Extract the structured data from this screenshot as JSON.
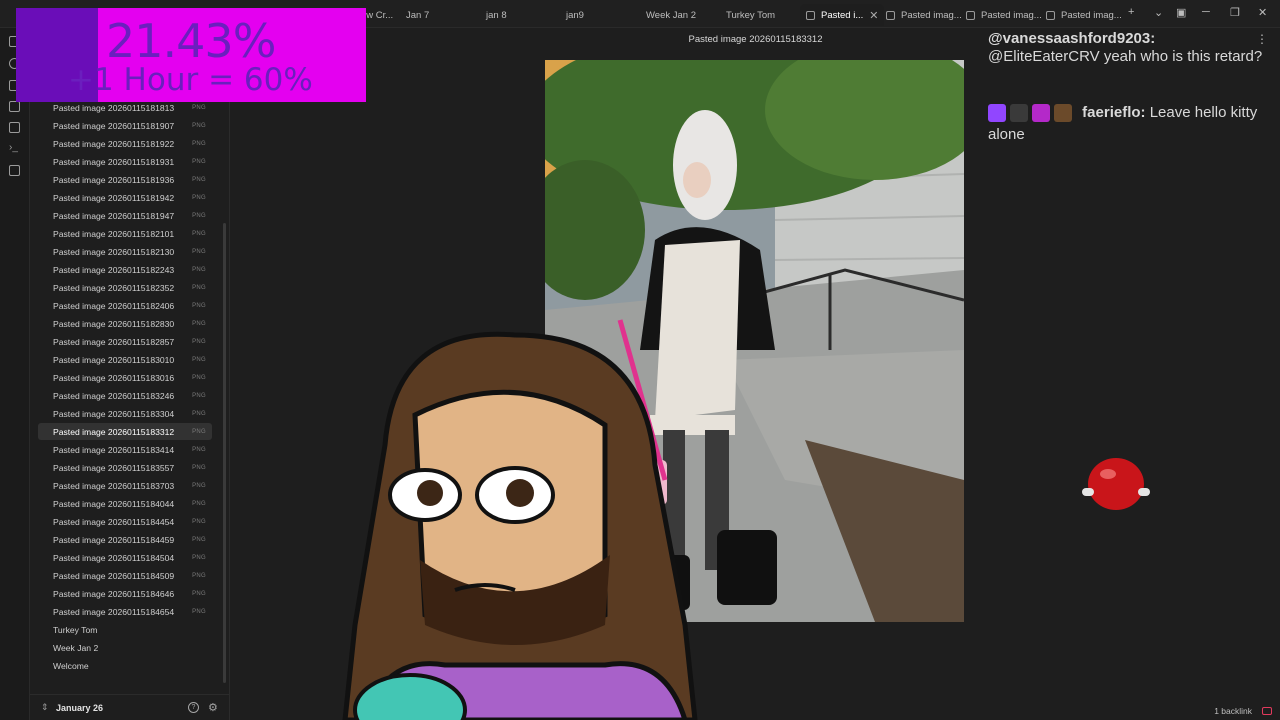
{
  "tabs": [
    {
      "label": "ew Cr..."
    },
    {
      "label": "Jan 7"
    },
    {
      "label": "jan 8"
    },
    {
      "label": "jan9"
    },
    {
      "label": "Week Jan 2"
    },
    {
      "label": "Turkey Tom"
    },
    {
      "label": "Pasted i..."
    },
    {
      "label": "Pasted imag..."
    },
    {
      "label": "Pasted imag..."
    },
    {
      "label": "Pasted imag..."
    }
  ],
  "overlay": {
    "percent": "21.43%",
    "bonus": "+1 Hour = 60%"
  },
  "sidebar": {
    "files": [
      {
        "name": "Pasted image 20260115181813",
        "ext": "PNG"
      },
      {
        "name": "Pasted image 20260115181907",
        "ext": "PNG"
      },
      {
        "name": "Pasted image 20260115181922",
        "ext": "PNG"
      },
      {
        "name": "Pasted image 20260115181931",
        "ext": "PNG"
      },
      {
        "name": "Pasted image 20260115181936",
        "ext": "PNG"
      },
      {
        "name": "Pasted image 20260115181942",
        "ext": "PNG"
      },
      {
        "name": "Pasted image 20260115181947",
        "ext": "PNG"
      },
      {
        "name": "Pasted image 20260115182101",
        "ext": "PNG"
      },
      {
        "name": "Pasted image 20260115182130",
        "ext": "PNG"
      },
      {
        "name": "Pasted image 20260115182243",
        "ext": "PNG"
      },
      {
        "name": "Pasted image 20260115182352",
        "ext": "PNG"
      },
      {
        "name": "Pasted image 20260115182406",
        "ext": "PNG"
      },
      {
        "name": "Pasted image 20260115182830",
        "ext": "PNG"
      },
      {
        "name": "Pasted image 20260115182857",
        "ext": "PNG"
      },
      {
        "name": "Pasted image 20260115183010",
        "ext": "PNG"
      },
      {
        "name": "Pasted image 20260115183016",
        "ext": "PNG"
      },
      {
        "name": "Pasted image 20260115183246",
        "ext": "PNG"
      },
      {
        "name": "Pasted image 20260115183304",
        "ext": "PNG"
      },
      {
        "name": "Pasted image 20260115183312",
        "ext": "PNG",
        "active": true
      },
      {
        "name": "Pasted image 20260115183414",
        "ext": "PNG"
      },
      {
        "name": "Pasted image 20260115183557",
        "ext": "PNG"
      },
      {
        "name": "Pasted image 20260115183703",
        "ext": "PNG"
      },
      {
        "name": "Pasted image 20260115184044",
        "ext": "PNG"
      },
      {
        "name": "Pasted image 20260115184454",
        "ext": "PNG"
      },
      {
        "name": "Pasted image 20260115184459",
        "ext": "PNG"
      },
      {
        "name": "Pasted image 20260115184504",
        "ext": "PNG"
      },
      {
        "name": "Pasted image 20260115184509",
        "ext": "PNG"
      },
      {
        "name": "Pasted image 20260115184646",
        "ext": "PNG"
      },
      {
        "name": "Pasted image 20260115184654",
        "ext": "PNG"
      },
      {
        "name": "Turkey Tom",
        "ext": ""
      },
      {
        "name": "Week Jan 2",
        "ext": ""
      },
      {
        "name": "Welcome",
        "ext": ""
      }
    ],
    "vault_name": "January 26"
  },
  "main": {
    "title": "Pasted image 20260115183312",
    "backlinks": "1 backlink"
  },
  "chat": [
    {
      "name": "@vanessaashford9203:",
      "text": "@EliteEaterCRV yeah who is this retard?"
    },
    {
      "name": "faerieflo:",
      "text": "Leave hello kitty alone"
    }
  ],
  "colors": {
    "overlay_magenta": "#e400f0",
    "overlay_purple": "#6b1fbe",
    "accent_red": "#e23a5d",
    "badge_purple": "#9146ff"
  }
}
